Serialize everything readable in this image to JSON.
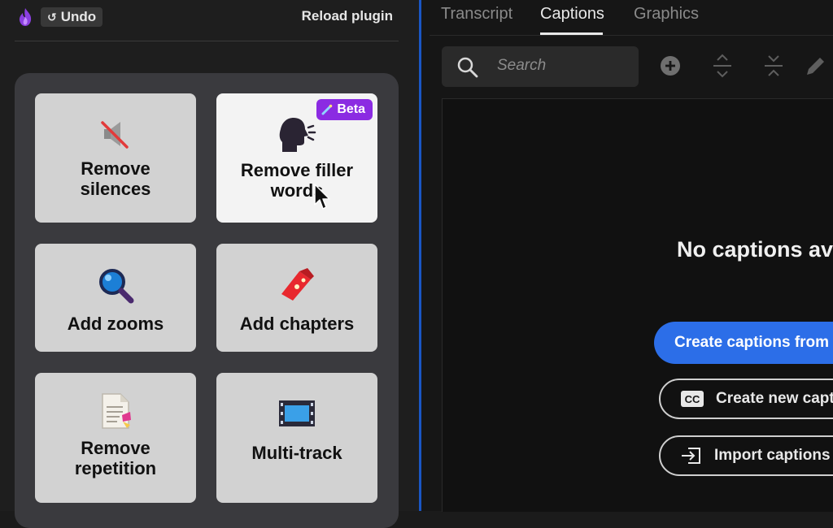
{
  "plugin": {
    "undo_label": "Undo",
    "reload_label": "Reload plugin",
    "accent_color": "#8b2be2",
    "tiles": [
      {
        "label_line1": "Remove",
        "label_line2": "silences",
        "icon": "muted-speaker-icon"
      },
      {
        "label_line1": "Remove filler",
        "label_line2": "words",
        "icon": "speaking-head-icon",
        "badge": "Beta"
      },
      {
        "label_line1": "Add zooms",
        "label_line2": "",
        "icon": "magnifier-icon"
      },
      {
        "label_line1": "Add chapters",
        "label_line2": "",
        "icon": "bookmark-ribbon-icon"
      },
      {
        "label_line1": "Remove",
        "label_line2": "repetition",
        "icon": "document-icon"
      },
      {
        "label_line1": "Multi-track",
        "label_line2": "",
        "icon": "film-strip-icon"
      }
    ]
  },
  "tabs": [
    {
      "label": "Transcript",
      "active": false
    },
    {
      "label": "Captions",
      "active": true
    },
    {
      "label": "Graphics",
      "active": false
    }
  ],
  "search": {
    "placeholder": "Search"
  },
  "captions": {
    "empty_message": "No captions ava",
    "primary_button": "Create captions from t",
    "create_new_button": "Create new capti",
    "import_button": "Import captions"
  },
  "colors": {
    "primary_blue": "#2c6ee8",
    "separator_blue": "#1a56c4"
  }
}
